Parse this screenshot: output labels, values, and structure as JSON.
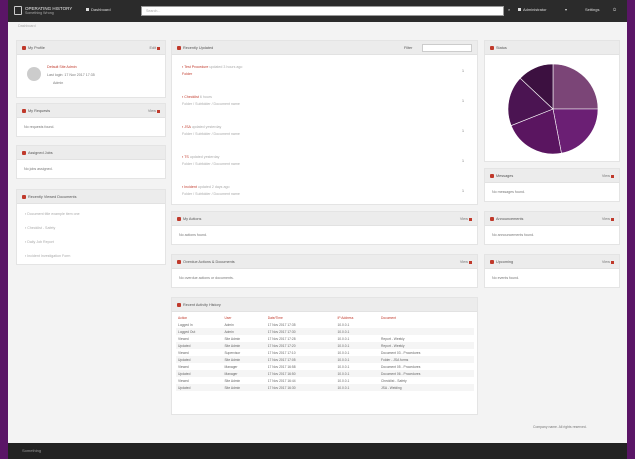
{
  "topbar": {
    "app_title": "OPERATING HISTORY",
    "app_subtitle": "Something Wrong",
    "dashboard_label": "Dashboard",
    "search_placeholder": "Search...",
    "user_label": "Administrator",
    "settings_label": "Settings",
    "logout_label": "Logout"
  },
  "breadcrumb": "Dashboard",
  "my_profile": {
    "title": "My Profile",
    "action": "Edit",
    "name": "Default Site Admin",
    "last_login": "Last login: 17 Nov 2017 17:35",
    "role": "Admin"
  },
  "my_requests": {
    "title": "My Requests",
    "action": "View",
    "empty": "No requests found."
  },
  "assigned_jobs": {
    "title": "Assigned Jobs",
    "empty": "No jobs assigned."
  },
  "recently_viewed": {
    "title": "Recently Viewed Documents",
    "items": [
      "Document title example item one",
      "Checklist - Safety",
      "Daily Job Report",
      "Incident Investigation Form"
    ]
  },
  "recent_activity": {
    "title": "Recently Updated",
    "filter_label": "Filter",
    "items": [
      {
        "title": "Test Procedure",
        "meta": "updated 3 hours ago",
        "sub": "Folder"
      },
      {
        "title": "Checklist",
        "meta": "6 hours",
        "sub": "Folder / Subfolder / Document name"
      },
      {
        "title": "JSA",
        "meta": "updated yesterday",
        "sub": "Folder / Subfolder / Document name"
      },
      {
        "title": "TS",
        "meta": "updated yesterday",
        "sub": "Folder / Subfolder / Document name"
      },
      {
        "title": "Incident",
        "meta": "updated 2 days ago",
        "sub": "Folder / Subfolder / Document name"
      }
    ]
  },
  "my_actions": {
    "title": "My Actions",
    "action": "View",
    "empty": "No actions found."
  },
  "overdue_actions": {
    "title": "Overdue Actions & Documents",
    "action": "View",
    "empty": "No overdue actions or documents."
  },
  "audit_log": {
    "title": "Recent Activity History",
    "columns": [
      "Action",
      "User",
      "Date/Time",
      "IP Address",
      "Document"
    ],
    "rows": [
      [
        "Logged In",
        "Admin",
        "17 Nov 2017 17:35",
        "10.0.0.1",
        ""
      ],
      [
        "Logged Out",
        "Admin",
        "17 Nov 2017 17:30",
        "10.0.0.1",
        ""
      ],
      [
        "Viewed",
        "Site Admin",
        "17 Nov 2017 17:28",
        "10.0.0.1",
        "Report - Weekly"
      ],
      [
        "Updated",
        "Site Admin",
        "17 Nov 2017 17:20",
        "10.0.0.1",
        "Report - Weekly"
      ],
      [
        "Viewed",
        "Supervisor",
        "17 Nov 2017 17:10",
        "10.0.0.1",
        "Document 03 - Procedures"
      ],
      [
        "Updated",
        "Site Admin",
        "17 Nov 2017 17:05",
        "10.0.0.1",
        "Folder - JSA forms"
      ],
      [
        "Viewed",
        "Manager",
        "17 Nov 2017 16:58",
        "10.0.0.1",
        "Document 05 - Procedures"
      ],
      [
        "Updated",
        "Manager",
        "17 Nov 2017 16:50",
        "10.0.0.1",
        "Document 06 - Procedures"
      ],
      [
        "Viewed",
        "Site Admin",
        "17 Nov 2017 16:44",
        "10.0.0.1",
        "Checklist - Safety"
      ],
      [
        "Updated",
        "Site Admin",
        "17 Nov 2017 16:30",
        "10.0.0.1",
        "JSA - Welding"
      ]
    ]
  },
  "status_chart": {
    "title": "Status"
  },
  "chart_data": {
    "type": "pie",
    "slices": [
      {
        "value": 25,
        "color": "#7b4577"
      },
      {
        "value": 22,
        "color": "#6b1f74"
      },
      {
        "value": 22,
        "color": "#5a1560"
      },
      {
        "value": 18,
        "color": "#4b1452"
      },
      {
        "value": 13,
        "color": "#3c1040"
      }
    ]
  },
  "messages": {
    "title": "Messages",
    "action": "View",
    "empty": "No messages found."
  },
  "announcements": {
    "title": "Announcements",
    "action": "View",
    "empty": "No announcements found."
  },
  "upcoming": {
    "title": "Upcoming",
    "action": "View",
    "empty": "No events found."
  },
  "footer": {
    "note": "Company name. All rights reserved.",
    "logo": "Something"
  }
}
